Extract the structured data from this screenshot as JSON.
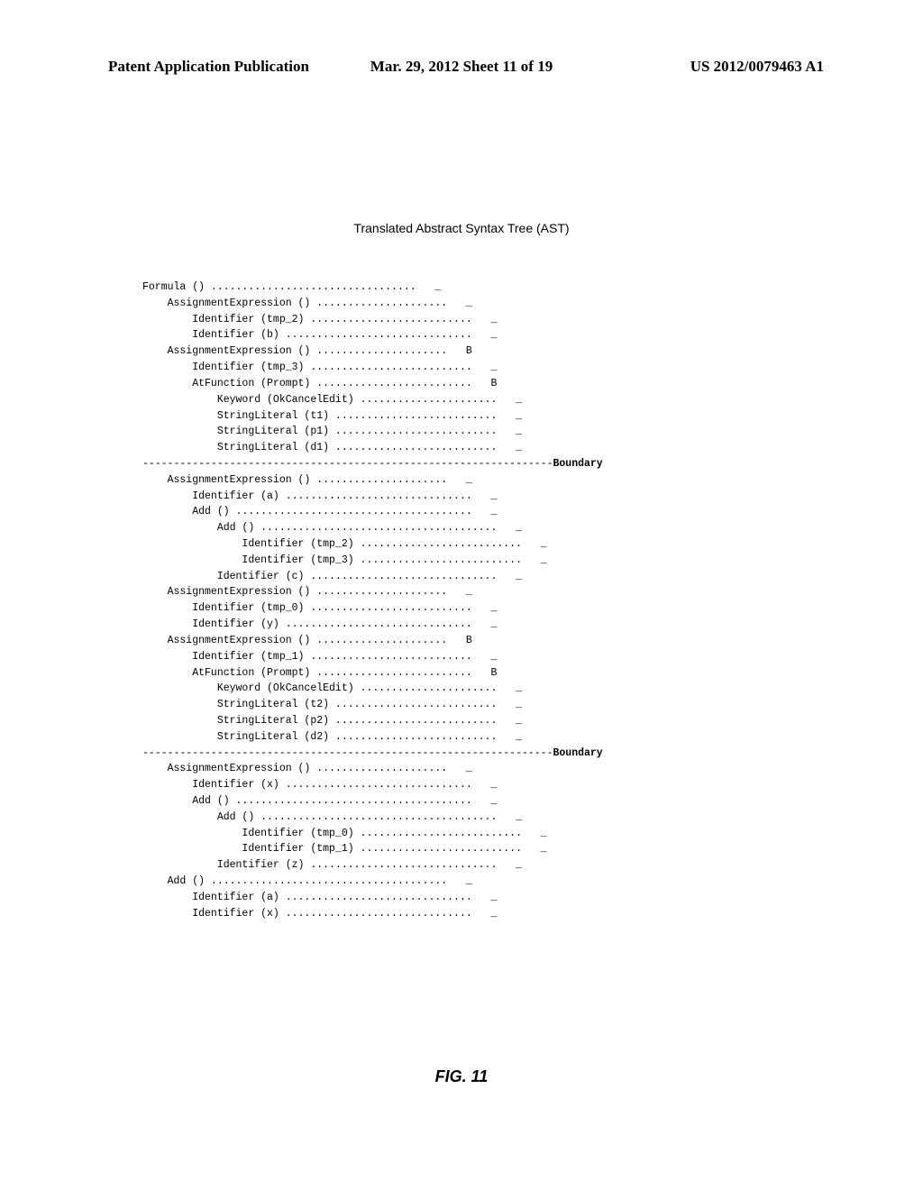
{
  "header": {
    "left": "Patent Application Publication",
    "center": "Mar. 29, 2012  Sheet 11 of 19",
    "right": "US 2012/0079463 A1"
  },
  "title": "Translated Abstract Syntax Tree (AST)",
  "ast": {
    "sections": [
      {
        "lines": [
          {
            "indent": 0,
            "label": "Formula ()",
            "mark": "_",
            "markcol": 44
          },
          {
            "indent": 1,
            "label": "AssignmentExpression ()",
            "mark": "_",
            "markcol": 49
          },
          {
            "indent": 2,
            "label": "Identifier (tmp_2)",
            "mark": "_",
            "markcol": 53
          },
          {
            "indent": 2,
            "label": "Identifier (b)",
            "mark": "_",
            "markcol": 53
          },
          {
            "indent": 1,
            "label": "AssignmentExpression ()",
            "mark": "B",
            "markcol": 49
          },
          {
            "indent": 2,
            "label": "Identifier (tmp_3)",
            "mark": "_",
            "markcol": 53
          },
          {
            "indent": 2,
            "label": "AtFunction (Prompt)",
            "mark": "B",
            "markcol": 53
          },
          {
            "indent": 3,
            "label": "Keyword (OkCancelEdit)",
            "mark": "_",
            "markcol": 57
          },
          {
            "indent": 3,
            "label": "StringLiteral (t1)",
            "mark": "_",
            "markcol": 57
          },
          {
            "indent": 3,
            "label": "StringLiteral (p1)",
            "mark": "_",
            "markcol": 57
          },
          {
            "indent": 3,
            "label": "StringLiteral (d1)",
            "mark": "_",
            "markcol": 57
          }
        ],
        "boundary": true
      },
      {
        "lines": [
          {
            "indent": 1,
            "label": "AssignmentExpression ()",
            "mark": "_",
            "markcol": 49
          },
          {
            "indent": 2,
            "label": "Identifier (a)",
            "mark": "_",
            "markcol": 53
          },
          {
            "indent": 2,
            "label": "Add ()",
            "mark": "_",
            "markcol": 53
          },
          {
            "indent": 3,
            "label": "Add ()",
            "mark": "_",
            "markcol": 57
          },
          {
            "indent": 4,
            "label": "Identifier (tmp_2)",
            "mark": "_",
            "markcol": 61
          },
          {
            "indent": 4,
            "label": "Identifier (tmp_3)",
            "mark": "_",
            "markcol": 61
          },
          {
            "indent": 3,
            "label": "Identifier (c)",
            "mark": "_",
            "markcol": 57
          },
          {
            "indent": 1,
            "label": "AssignmentExpression ()",
            "mark": "_",
            "markcol": 49
          },
          {
            "indent": 2,
            "label": "Identifier (tmp_0)",
            "mark": "_",
            "markcol": 53
          },
          {
            "indent": 2,
            "label": "Identifier (y)",
            "mark": "_",
            "markcol": 53
          },
          {
            "indent": 1,
            "label": "AssignmentExpression ()",
            "mark": "B",
            "markcol": 49
          },
          {
            "indent": 2,
            "label": "Identifier (tmp_1)",
            "mark": "_",
            "markcol": 53
          },
          {
            "indent": 2,
            "label": "AtFunction (Prompt)",
            "mark": "B",
            "markcol": 53
          },
          {
            "indent": 3,
            "label": "Keyword (OkCancelEdit)",
            "mark": "_",
            "markcol": 57
          },
          {
            "indent": 3,
            "label": "StringLiteral (t2)",
            "mark": "_",
            "markcol": 57
          },
          {
            "indent": 3,
            "label": "StringLiteral (p2)",
            "mark": "_",
            "markcol": 57
          },
          {
            "indent": 3,
            "label": "StringLiteral (d2)",
            "mark": "_",
            "markcol": 57
          }
        ],
        "boundary": true
      },
      {
        "lines": [
          {
            "indent": 1,
            "label": "AssignmentExpression ()",
            "mark": "_",
            "markcol": 49
          },
          {
            "indent": 2,
            "label": "Identifier (x)",
            "mark": "_",
            "markcol": 53
          },
          {
            "indent": 2,
            "label": "Add ()",
            "mark": "_",
            "markcol": 53
          },
          {
            "indent": 3,
            "label": "Add ()",
            "mark": "_",
            "markcol": 57
          },
          {
            "indent": 4,
            "label": "Identifier (tmp_0)",
            "mark": "_",
            "markcol": 61
          },
          {
            "indent": 4,
            "label": "Identifier (tmp_1)",
            "mark": "_",
            "markcol": 61
          },
          {
            "indent": 3,
            "label": "Identifier (z)",
            "mark": "_",
            "markcol": 57
          },
          {
            "indent": 1,
            "label": "Add ()",
            "mark": "_",
            "markcol": 49
          },
          {
            "indent": 2,
            "label": "Identifier (a)",
            "mark": "_",
            "markcol": 53
          },
          {
            "indent": 2,
            "label": "Identifier (x)",
            "mark": "_",
            "markcol": 53
          }
        ],
        "boundary": false
      }
    ],
    "boundary_label": "Boundary"
  },
  "figure_label": "FIG. 11"
}
